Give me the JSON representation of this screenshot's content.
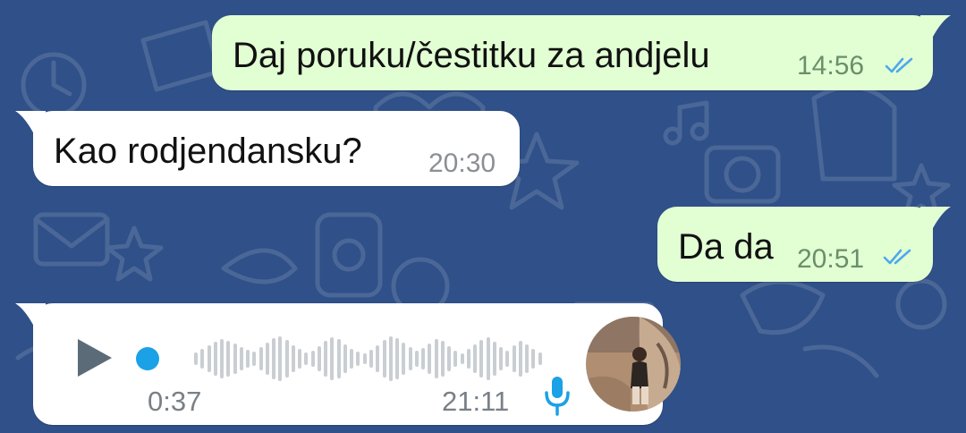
{
  "theme": {
    "wallpaper_color": "#2f5088",
    "outgoing_bubble": "#e2ffd4",
    "incoming_bubble": "#ffffff",
    "read_tick_color": "#4fa8ec",
    "voice_accent": "#1aa1e6"
  },
  "messages": [
    {
      "direction": "outgoing",
      "text": "Daj poruku/čestitku za andjelu",
      "time": "14:56",
      "status": "read",
      "status_icon": "double-check-icon"
    },
    {
      "direction": "incoming",
      "text": "Kao rodjendansku?",
      "time": "20:30"
    },
    {
      "direction": "outgoing",
      "text": "Da da",
      "time": "20:51",
      "status": "read",
      "status_icon": "double-check-icon"
    }
  ],
  "voice_message": {
    "direction": "incoming",
    "duration": "0:37",
    "time": "21:11",
    "progress": 0,
    "play_icon": "play-icon",
    "mic_icon": "microphone-icon",
    "avatar_icon": "sender-avatar"
  }
}
